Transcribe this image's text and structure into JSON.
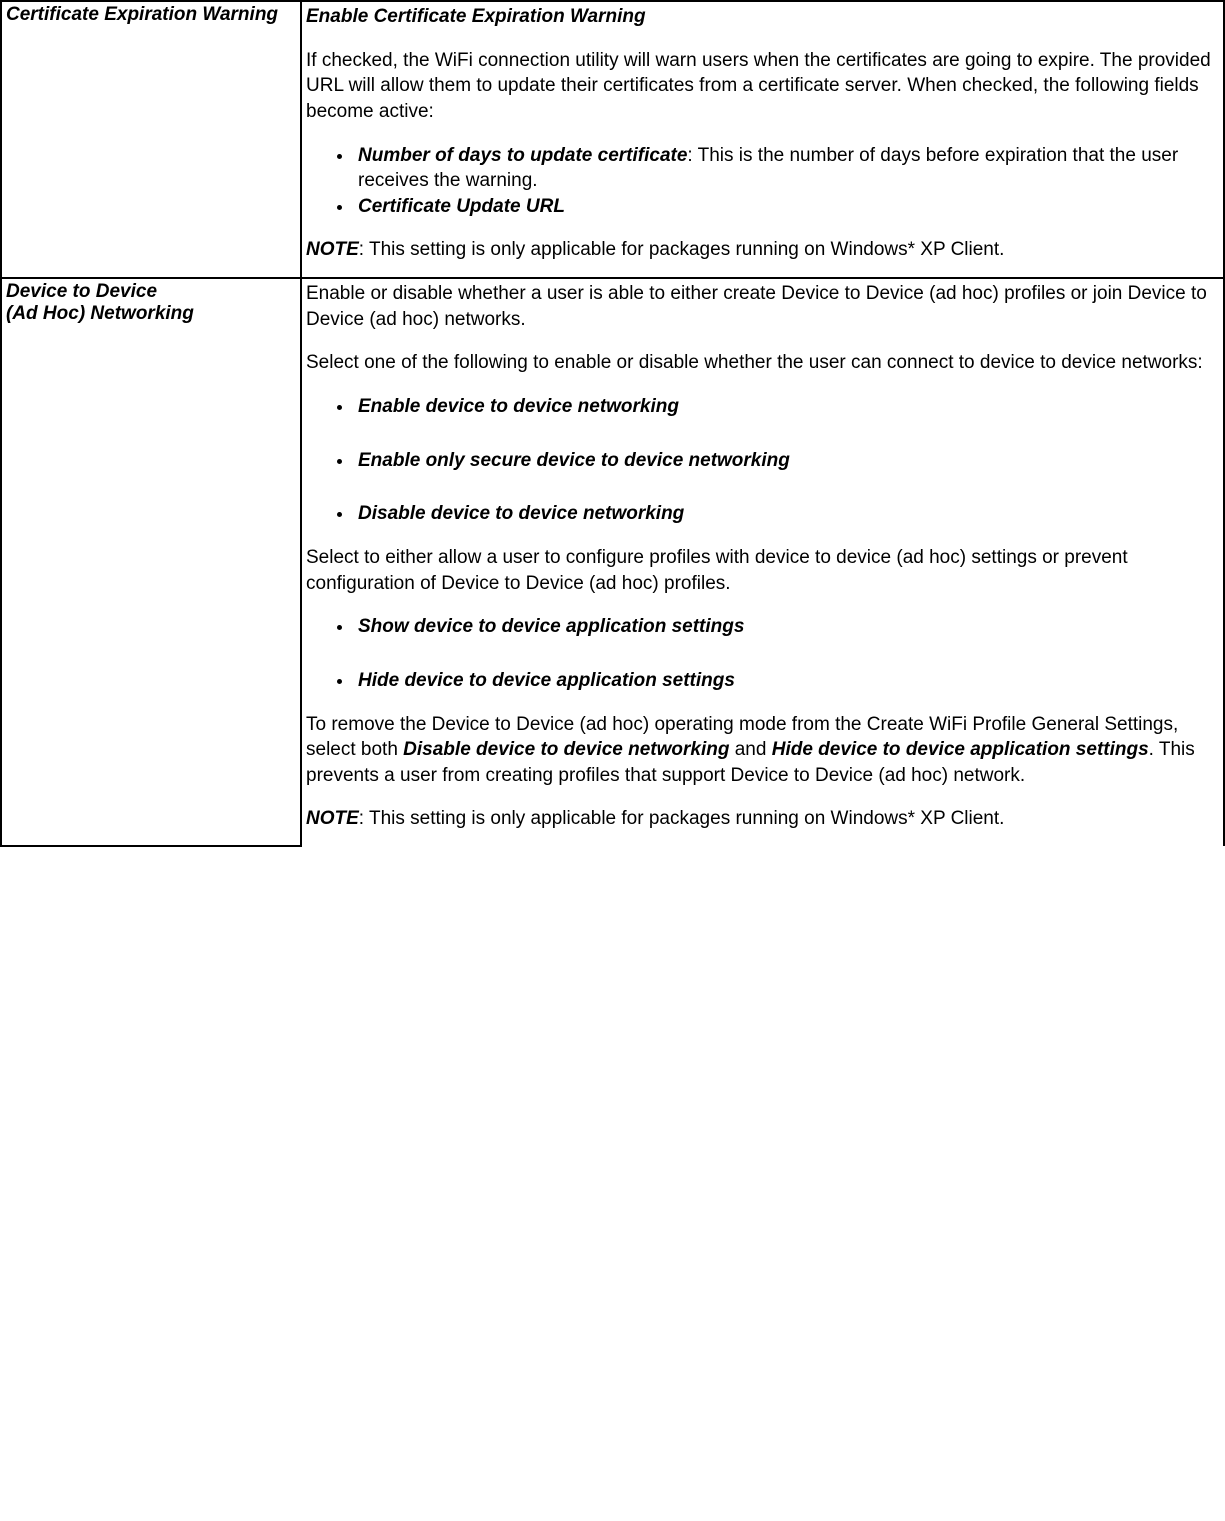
{
  "rows": [
    {
      "name": "Certificate Expiration Warning",
      "heading": "Enable Certificate Expiration Warning",
      "p1": "If checked, the WiFi connection utility will warn users when the certificates are going to expire. The provided URL will allow them to update their certificates from a certificate server. When checked, the following fields become active:",
      "bullets": [
        {
          "bold": "Number of days to update certificate",
          "rest": ": This is the number of days before expiration that the user receives the warning."
        },
        {
          "bold": "Certificate Update URL",
          "rest": ""
        }
      ],
      "note_label": "NOTE",
      "note_text": ": This setting is only applicable for packages running on Windows* XP Client."
    },
    {
      "name_line1": "Device to Device",
      "name_line2": "(Ad Hoc) Networking",
      "p1": "Enable or disable whether a user is able to either create Device to Device (ad hoc) profiles or join Device to Device (ad hoc) networks.",
      "p2": "Select one of the following to enable or disable whether the user can connect to device to device networks:",
      "bullets1": [
        "Enable device to device networking",
        "Enable only secure device to device networking",
        "Disable device to device networking"
      ],
      "p3": "Select to either allow a user to configure profiles with device to device (ad hoc) settings or prevent configuration of Device to Device (ad hoc) profiles.",
      "bullets2": [
        "Show device to device application settings",
        "Hide device to device application settings"
      ],
      "p4_pre": "To remove the Device to Device (ad hoc) operating mode from the Create WiFi Profile General Settings, select both ",
      "p4_b1": "Disable device to device networking",
      "p4_mid": " and ",
      "p4_b2": "Hide device to device application settings",
      "p4_post": ". This prevents a user from creating profiles that support Device to Device (ad hoc) network.",
      "note_label": "NOTE",
      "note_text": ": This setting is only applicable for packages running on Windows* XP Client."
    }
  ]
}
